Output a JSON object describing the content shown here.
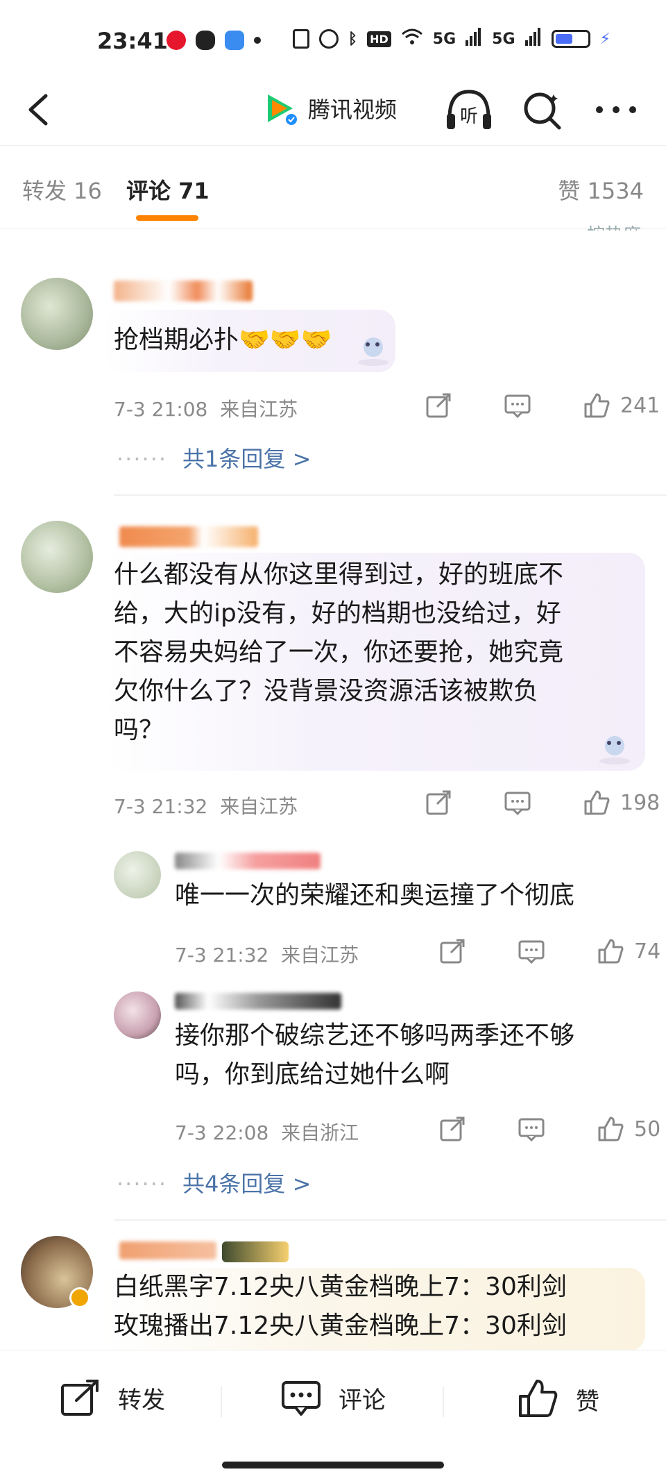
{
  "status_bar": {
    "time": "23:41",
    "network_1": "5G",
    "network_2": "5G",
    "battery_level": 0.55
  },
  "nav": {
    "title": "腾讯视频",
    "listen_label": "听"
  },
  "tabs": {
    "repost": "转发 16",
    "comment": "评论 71",
    "like": "赞 1534",
    "sort_peek": "按热度"
  },
  "comments": [
    {
      "text": "抢档期必扑🤝🤝🤝",
      "time": "7-3 21:08",
      "location": "来自江苏",
      "likes": "241",
      "more_replies": "共1条回复 >"
    },
    {
      "text_lines": [
        "什么都没有从你这里得到过，好的班底不",
        "给，大的ip没有，好的档期也没给过，好",
        "不容易央妈给了一次，你还要抢，她究竟",
        "欠你什么了？没背景没资源活该被欺负",
        "吗？"
      ],
      "time": "7-3 21:32",
      "location": "来自江苏",
      "likes": "198",
      "replies": [
        {
          "text": "唯一一次的荣耀还和奥运撞了个彻底",
          "time": "7-3 21:32",
          "location": "来自江苏",
          "likes": "74"
        },
        {
          "text_lines": [
            "接你那个破综艺还不够吗两季还不够",
            "吗，你到底给过她什么啊"
          ],
          "time": "7-3 22:08",
          "location": "来自浙江",
          "likes": "50"
        }
      ],
      "more_replies": "共4条回复 >"
    },
    {
      "text_lines": [
        "白纸黑字7.12央八黄金档晚上7：30利剑",
        "玫瑰播出7.12央八黄金档晚上7：30利剑"
      ]
    }
  ],
  "bottom_bar": {
    "repost": "转发",
    "comment": "评论",
    "like": "赞"
  },
  "colors": {
    "accent_orange": "#ff8200",
    "link_blue": "#4b73a8",
    "meta_gray": "#8a8a8a"
  }
}
